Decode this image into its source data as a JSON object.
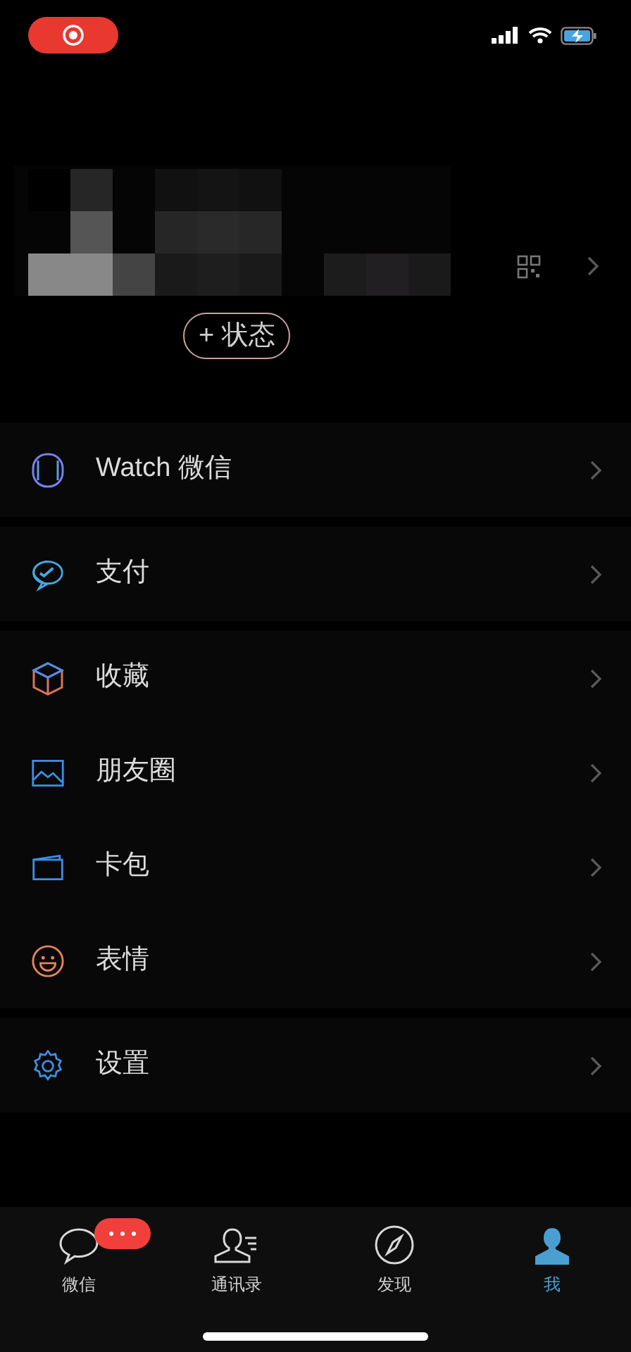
{
  "status_bar": {
    "recording": true
  },
  "profile": {
    "status_button": "+ 状态"
  },
  "menu_groups": [
    [
      {
        "label": "Watch 微信"
      }
    ],
    [
      {
        "label": "支付"
      }
    ],
    [
      {
        "label": "收藏"
      },
      {
        "label": "朋友圈"
      },
      {
        "label": "卡包"
      },
      {
        "label": "表情"
      }
    ],
    [
      {
        "label": "设置"
      }
    ]
  ],
  "tabs": [
    {
      "label": "微信",
      "selected": false,
      "badge": true
    },
    {
      "label": "通讯录",
      "selected": false,
      "badge": false
    },
    {
      "label": "发现",
      "selected": false,
      "badge": false
    },
    {
      "label": "我",
      "selected": true,
      "badge": false
    }
  ]
}
